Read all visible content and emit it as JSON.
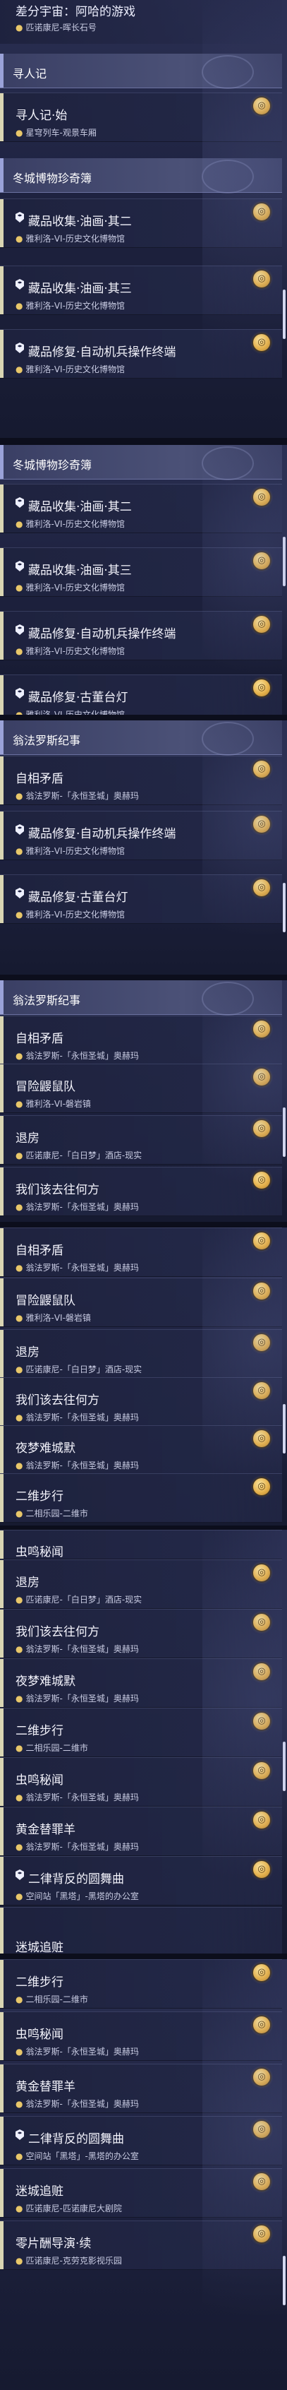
{
  "quest_icon": "quest-coin-icon",
  "location_icon": "map-pin-icon",
  "top": {
    "title": "差分宇宙：阿哈的游戏",
    "location": "匹诺康尼-晖长石号"
  },
  "sections": {
    "xunrenji": "寻人记",
    "dongcheng": "冬城博物珍奇簿",
    "wengfaluosi": "翁法罗斯纪事"
  },
  "q": {
    "xunren": {
      "title": "寻人记·始",
      "location": "星穹列车-观景车厢"
    },
    "c2": {
      "title": "藏品收集·油画·其二",
      "location": "雅利洛-VI-历史文化博物馆"
    },
    "c3": {
      "title": "藏品收集·油画·其三",
      "location": "雅利洛-VI-历史文化博物馆"
    },
    "c4": {
      "title": "藏品修复·自动机兵操作终端",
      "location": "雅利洛-VI-历史文化博物馆"
    },
    "c5": {
      "title": "藏品修复·古董台灯",
      "location": "雅利洛-VI-历史文化博物馆"
    },
    "zx": {
      "title": "自相矛盾",
      "location": "翁法罗斯-「永恒圣城」奥赫玛"
    },
    "mx": {
      "title": "冒险鼹鼠队",
      "location": "雅利洛-VI-磐岩镇"
    },
    "tf": {
      "title": "退房",
      "location": "匹诺康尼-「白日梦」酒店-现实"
    },
    "wm": {
      "title": "我们该去往何方",
      "location": "翁法罗斯-「永恒圣城」奥赫玛"
    },
    "ym": {
      "title": "夜梦难城默",
      "location": "翁法罗斯-「永恒圣城」奥赫玛"
    },
    "eb": {
      "title": "二维步行",
      "location": "二相乐园-二维市"
    },
    "cm": {
      "title": "虫鸣秘闻",
      "location": "翁法罗斯-「永恒圣城」奥赫玛"
    },
    "hj": {
      "title": "黄金替罪羊",
      "location": "翁法罗斯-「永恒圣城」奥赫玛"
    },
    "el": {
      "title": "二律背反的圆舞曲",
      "location": "空间站「黑塔」-黑塔的办公室"
    },
    "mc": {
      "title": "迷城追赃",
      "location": "匹诺康尼-匹诺康尼大剧院"
    },
    "lp": {
      "title": "零片酬导演·续",
      "location": "匹诺康尼-克劳克影视乐园"
    }
  },
  "cut": {
    "ymd_partial": "夜梦难城默",
    "cm_partial": "虫鸣秘闻",
    "mc_partial": "迷城追赃"
  }
}
